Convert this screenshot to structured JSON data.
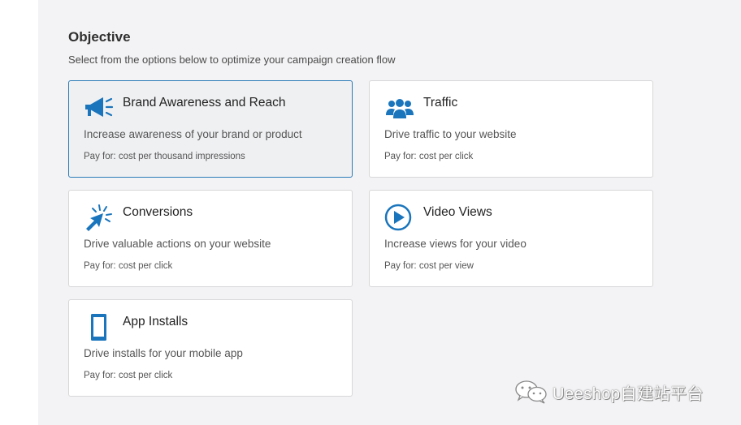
{
  "header": {
    "title": "Objective",
    "subtitle": "Select from the options below to optimize your campaign creation flow"
  },
  "accent_color": "#1a75bc",
  "selected_border_color": "#2b7bb8",
  "options": [
    {
      "icon": "megaphone-icon",
      "title": "Brand Awareness and Reach",
      "description": "Increase awareness of your brand or product",
      "pay_for": "Pay for: cost per thousand impressions",
      "selected": true
    },
    {
      "icon": "people-icon",
      "title": "Traffic",
      "description": "Drive traffic to your website",
      "pay_for": "Pay for: cost per click",
      "selected": false
    },
    {
      "icon": "cursor-click-icon",
      "title": "Conversions",
      "description": "Drive valuable actions on your website",
      "pay_for": "Pay for: cost per click",
      "selected": false
    },
    {
      "icon": "play-circle-icon",
      "title": "Video Views",
      "description": "Increase views for your video",
      "pay_for": "Pay for: cost per view",
      "selected": false
    },
    {
      "icon": "mobile-phone-icon",
      "title": "App Installs",
      "description": "Drive installs for your mobile app",
      "pay_for": "Pay for: cost per click",
      "selected": false
    }
  ],
  "watermark": {
    "icon": "wechat-icon",
    "text": "Ueeshop自建站平台"
  }
}
